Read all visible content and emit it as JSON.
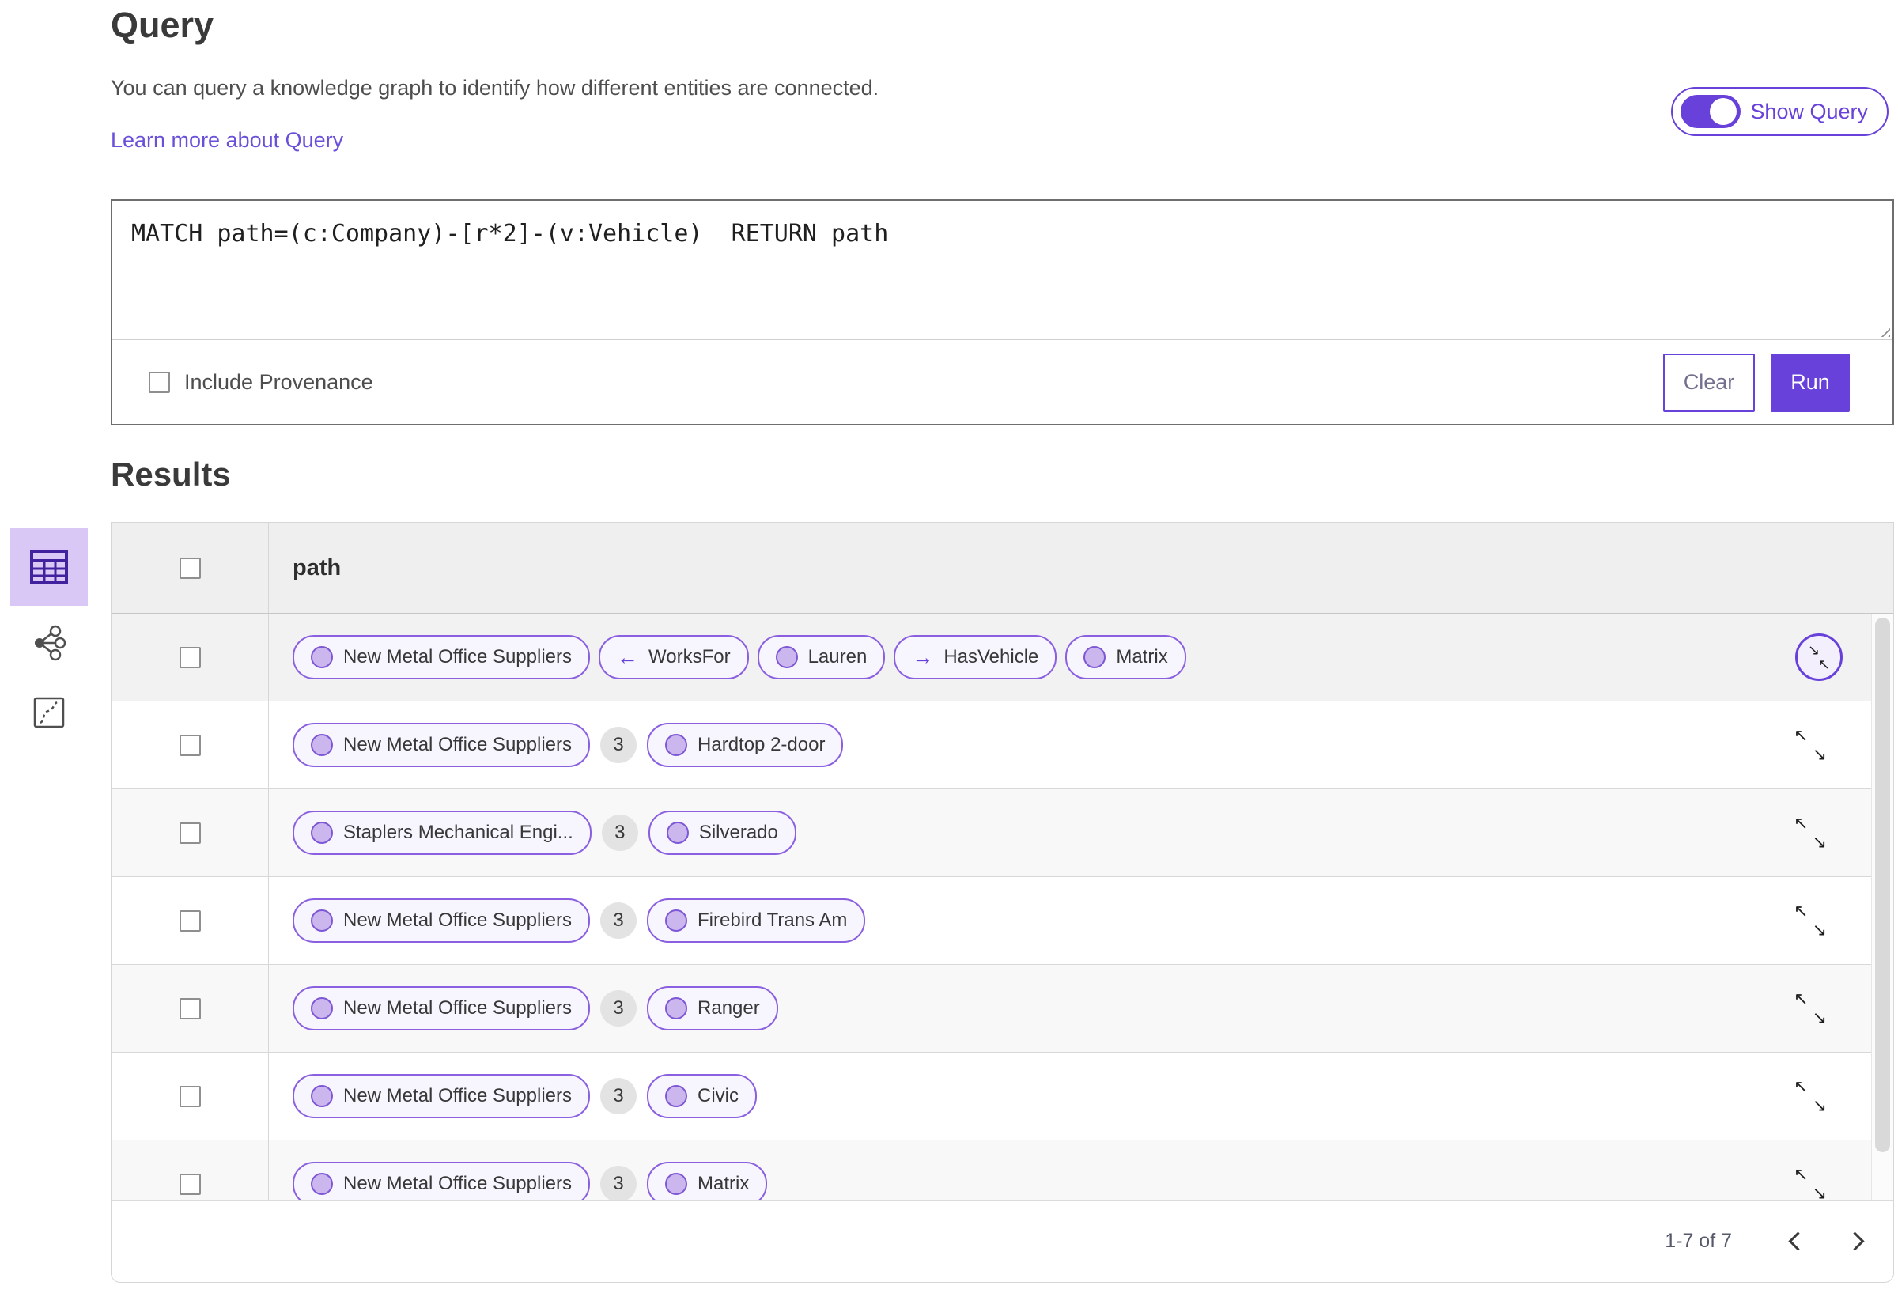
{
  "colors": {
    "accent": "#6741D9",
    "link": "#6A4FD8",
    "chip_border": "#8A5FE0",
    "chip_bg": "#F7F5FD",
    "node_fill": "#CBB6EE",
    "node_border": "#7D57D6",
    "count_bg": "#E3E3E3"
  },
  "header": {
    "title": "Query",
    "description": "You can query a knowledge graph to identify how different entities are connected.",
    "learn_more": "Learn more about Query",
    "show_query_label": "Show Query",
    "show_query_state": "on"
  },
  "query_editor": {
    "query_text": "MATCH path=(c:Company)-[r*2]-(v:Vehicle)  RETURN path",
    "include_provenance_label": "Include Provenance",
    "include_provenance_checked": false,
    "clear_label": "Clear",
    "run_label": "Run"
  },
  "icons": {
    "arrow_left": "←",
    "arrow_right": "→",
    "expand_nw": "↖",
    "expand_se": "↘",
    "collapse_se": "↘",
    "collapse_nw": "↖"
  },
  "view_switcher": {
    "items": [
      "table-view",
      "graph-view",
      "map-view"
    ],
    "selected": "table-view"
  },
  "results": {
    "title": "Results",
    "column_header": "path",
    "rows": [
      {
        "expand_state": "collapse-circled",
        "cells": [
          {
            "type": "node",
            "label": "New Metal Office Suppliers"
          },
          {
            "type": "rel",
            "dir": "left",
            "label": "WorksFor"
          },
          {
            "type": "node",
            "label": "Lauren"
          },
          {
            "type": "rel",
            "dir": "right",
            "label": "HasVehicle"
          },
          {
            "type": "node",
            "label": "Matrix"
          }
        ]
      },
      {
        "expand_state": "expand",
        "cells": [
          {
            "type": "node",
            "label": "New Metal Office Suppliers"
          },
          {
            "type": "count",
            "label": "3"
          },
          {
            "type": "node",
            "label": "Hardtop 2-door"
          }
        ]
      },
      {
        "expand_state": "expand",
        "cells": [
          {
            "type": "node",
            "label": "Staplers Mechanical Engi..."
          },
          {
            "type": "count",
            "label": "3"
          },
          {
            "type": "node",
            "label": "Silverado"
          }
        ]
      },
      {
        "expand_state": "expand",
        "cells": [
          {
            "type": "node",
            "label": "New Metal Office Suppliers"
          },
          {
            "type": "count",
            "label": "3"
          },
          {
            "type": "node",
            "label": "Firebird Trans Am"
          }
        ]
      },
      {
        "expand_state": "expand",
        "cells": [
          {
            "type": "node",
            "label": "New Metal Office Suppliers"
          },
          {
            "type": "count",
            "label": "3"
          },
          {
            "type": "node",
            "label": "Ranger"
          }
        ]
      },
      {
        "expand_state": "expand",
        "cells": [
          {
            "type": "node",
            "label": "New Metal Office Suppliers"
          },
          {
            "type": "count",
            "label": "3"
          },
          {
            "type": "node",
            "label": "Civic"
          }
        ]
      },
      {
        "expand_state": "expand",
        "cells": [
          {
            "type": "node",
            "label": "New Metal Office Suppliers"
          },
          {
            "type": "count",
            "label": "3"
          },
          {
            "type": "node",
            "label": "Matrix"
          }
        ]
      }
    ],
    "pagination": {
      "range_label": "1-7 of 7"
    }
  }
}
